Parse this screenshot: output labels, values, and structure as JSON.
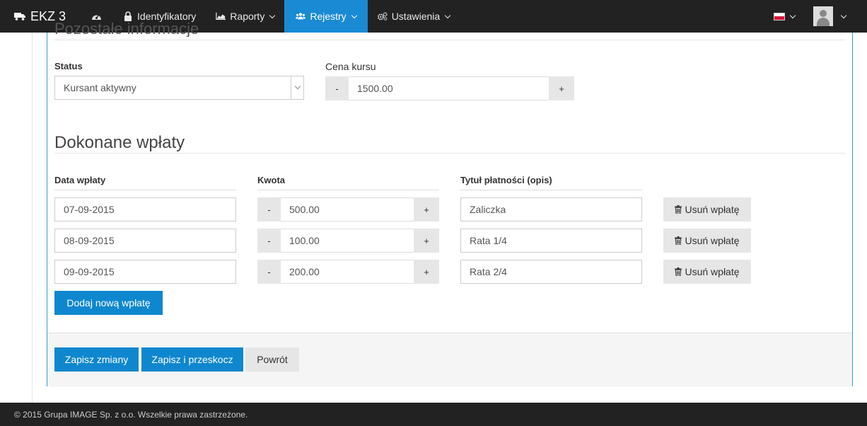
{
  "navbar": {
    "brand": "EKZ 3",
    "items": [
      {
        "label": "",
        "icon": "dashboard-icon"
      },
      {
        "label": "Identyfikatory",
        "icon": "lock-icon"
      },
      {
        "label": "Raporty",
        "icon": "area-chart-icon"
      },
      {
        "label": "Rejestry",
        "icon": "users-icon",
        "active": true
      },
      {
        "label": "Ustawienia",
        "icon": "cogs-icon"
      }
    ],
    "active_color": "#1a8ad4"
  },
  "form": {
    "cut_heading": "Pozostałe informacje",
    "status_label": "Status",
    "status_value": "Kursant aktywny",
    "price_label": "Cena kursu",
    "price_value": "1500.00",
    "minus": "-",
    "plus": "+"
  },
  "payments": {
    "title": "Dokonane wpłaty",
    "col_date": "Data wpłaty",
    "col_amount": "Kwota",
    "col_desc": "Tytuł płatności (opis)",
    "delete_label": "Usuń wpłatę",
    "rows": [
      {
        "date": "07-09-2015",
        "amount": "500.00",
        "desc": "Zaliczka"
      },
      {
        "date": "08-09-2015",
        "amount": "100.00",
        "desc": "Rata 1/4"
      },
      {
        "date": "09-09-2015",
        "amount": "200.00",
        "desc": "Rata 2/4"
      }
    ],
    "add_label": "Dodaj nową wpłatę"
  },
  "actions": {
    "save": "Zapisz zmiany",
    "save_skip": "Zapisz i przeskocz",
    "back": "Powrót"
  },
  "footer": {
    "text": "© 2015 Grupa IMAGE Sp. z o.o. Wszelkie prawa zastrzeżone."
  }
}
